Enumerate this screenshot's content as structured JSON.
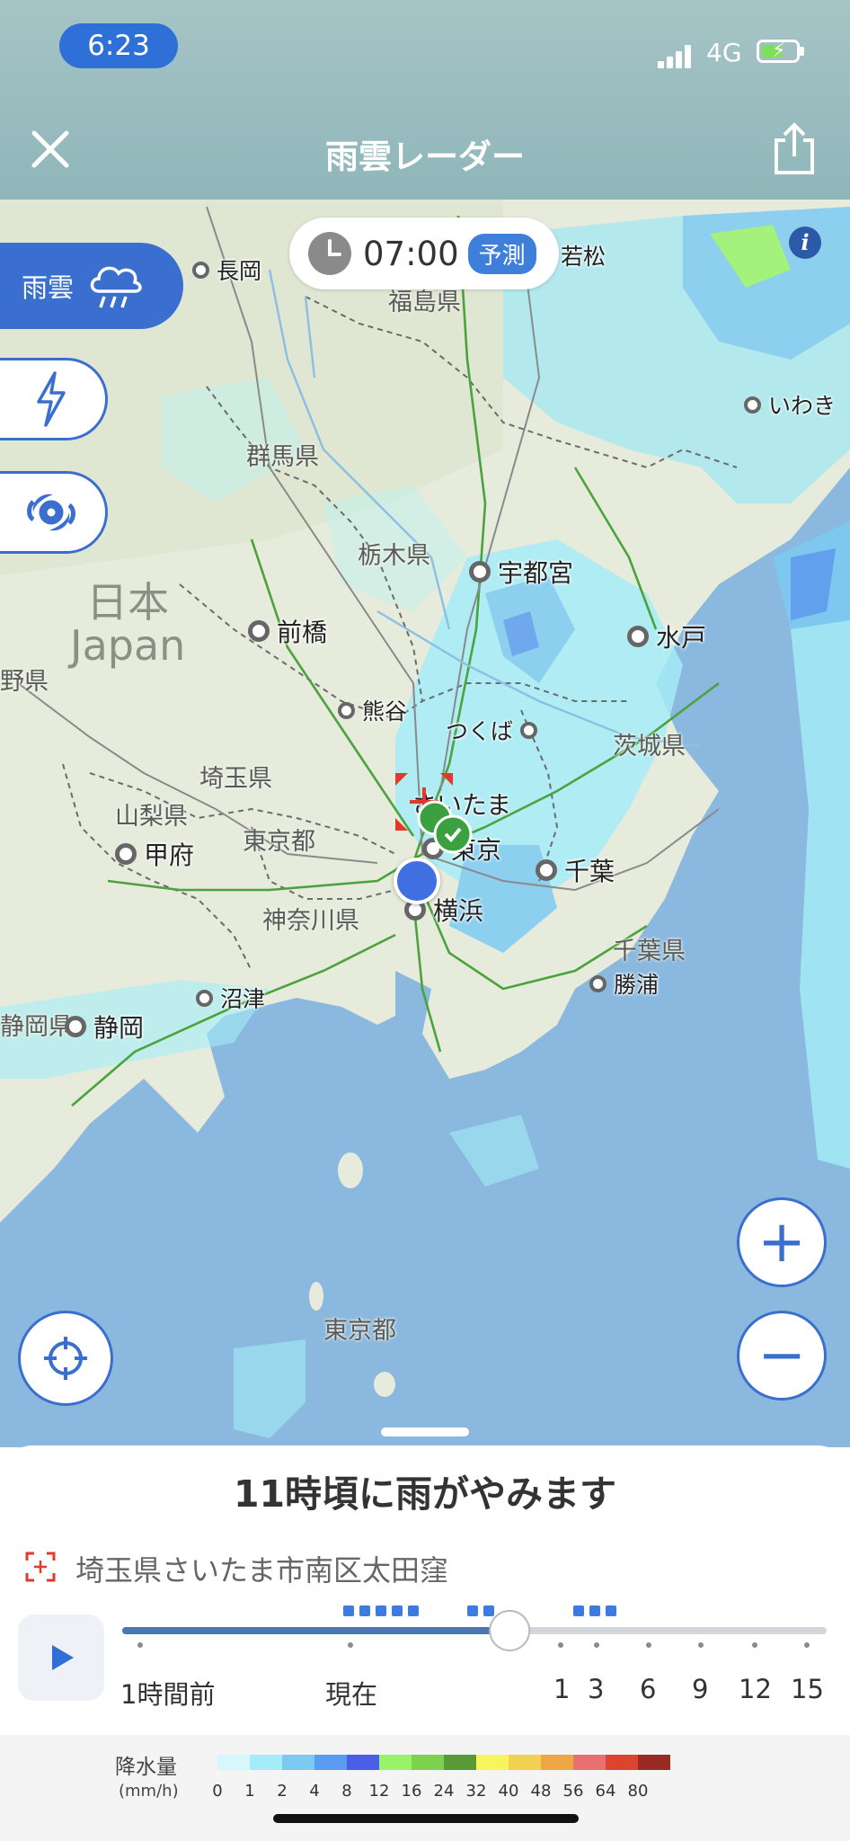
{
  "status_bar": {
    "time": "6:23",
    "network": "4G"
  },
  "header": {
    "title": "雨雲レーダー",
    "close_icon": "close-icon",
    "share_icon": "share-icon"
  },
  "map": {
    "time_chip": {
      "time": "07:00",
      "badge": "予測"
    },
    "layers": {
      "rain_label": "雨雲",
      "rain_icon": "rain-cloud-icon",
      "lightning_icon": "lightning-icon",
      "typhoon_icon": "typhoon-icon"
    },
    "info_label": "i",
    "country": {
      "ja": "日本",
      "en": "Japan"
    },
    "cities": {
      "nagaoka": "長岡",
      "wakamatsu": "若松",
      "iwaki": "いわき",
      "utsunomiya": "宇都宮",
      "maebashi": "前橋",
      "mito": "水戸",
      "kumagaya": "熊谷",
      "tsukuba": "つくば",
      "saitama": "さいたま",
      "tokyo": "東京",
      "kofu": "甲府",
      "chiba": "千葉",
      "yokohama": "横浜",
      "katsuura": "勝浦",
      "numazu": "沼津",
      "shizuoka": "静岡"
    },
    "prefectures": {
      "fukushima": "福島県",
      "gunma": "群馬県",
      "tochigi": "栃木県",
      "nagano": "野県",
      "ibaraki": "茨城県",
      "saitama": "埼玉県",
      "yamanashi": "山梨県",
      "tokyo": "東京都",
      "kanagawa": "神奈川県",
      "chiba": "千葉県",
      "shizuoka": "静岡県",
      "tokyo_islands": "東京都"
    },
    "controls": {
      "zoom_in": "+",
      "zoom_out": "−"
    }
  },
  "sheet": {
    "message": "11時頃に雨がやみます",
    "location": "埼玉県さいたま市南区太田窪",
    "timeline": {
      "labels": [
        "1時間前",
        "現在",
        "1",
        "3",
        "6",
        "9",
        "12",
        "15"
      ],
      "progress": 0.55
    }
  },
  "legend": {
    "title": "降水量",
    "unit": "(mm/h)",
    "colors": [
      "#d6f7fb",
      "#a4ecf7",
      "#7ccaf2",
      "#5a9cf0",
      "#4a5ee8",
      "#98f26a",
      "#7cd24e",
      "#5a9a36",
      "#f7f55c",
      "#f2d150",
      "#eda644",
      "#e87070",
      "#dc4430",
      "#9a2a24"
    ],
    "values": [
      "0",
      "1",
      "2",
      "4",
      "8",
      "12",
      "16",
      "24",
      "32",
      "40",
      "48",
      "56",
      "64",
      "80"
    ]
  }
}
